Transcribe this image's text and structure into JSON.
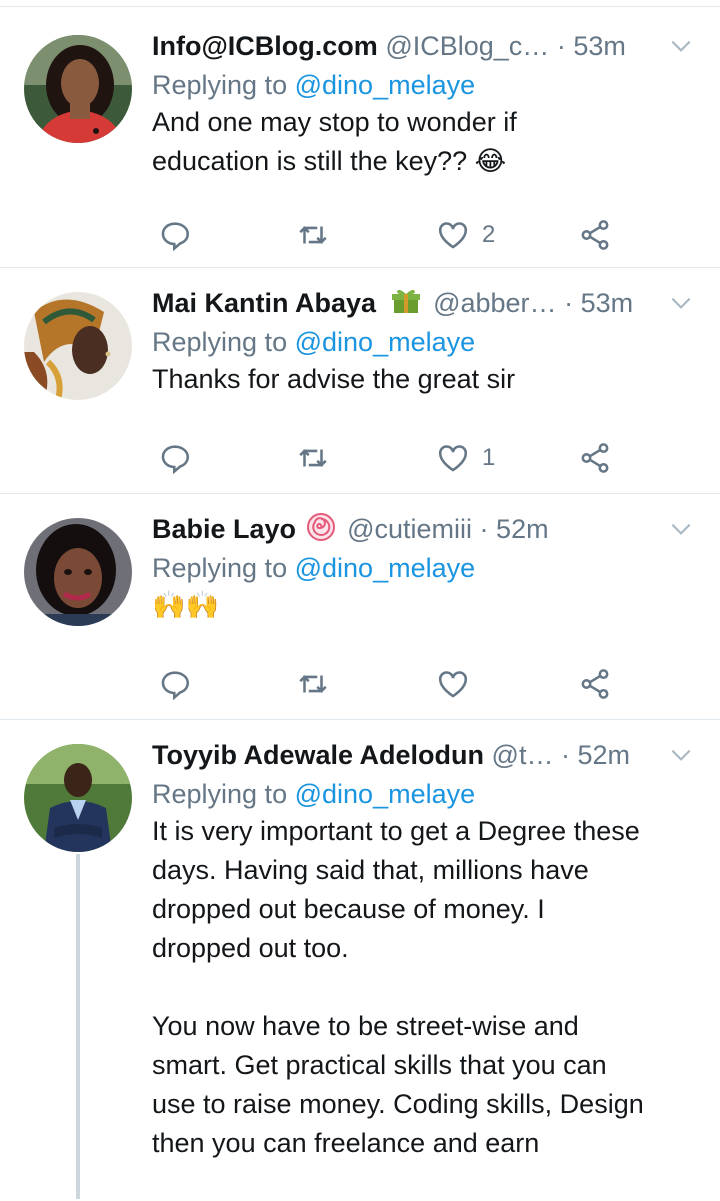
{
  "colors": {
    "link": "#1b95e0",
    "muted": "#657786",
    "divider": "#e1e8ed",
    "text": "#14171a"
  },
  "tweets": [
    {
      "name": "Info@ICBlog.com",
      "handle": "@ICBlog_c…",
      "dot": "·",
      "time": "53m",
      "reply_prefix": "Replying to",
      "reply_to": "@dino_melaye",
      "text": "And one may stop to wonder if\neducation is still the key?? 😂",
      "like_count": "2",
      "avatar": "woman-with-dark-hair-red-top"
    },
    {
      "name": "Mai Kantin Abaya",
      "badge_icon": "green-gift-emoji",
      "handle": "@abber…",
      "dot": "·",
      "time": "53m",
      "reply_prefix": "Replying to",
      "reply_to": "@dino_melaye",
      "text": "Thanks for advise the great sir",
      "like_count": "1",
      "avatar": "woman-with-headwrap"
    },
    {
      "name": "Babie Layo",
      "badge_icon": "swirl-lollipop-emoji",
      "handle": "@cutiemiii",
      "dot": "·",
      "time": "52m",
      "reply_prefix": "Replying to",
      "reply_to": "@dino_melaye",
      "text": "🙌🙌",
      "like_count": "",
      "avatar": "woman-selfie"
    },
    {
      "name": "Toyyib Adewale Adelodun",
      "handle": "@t…",
      "dot": "·",
      "time": "52m",
      "reply_prefix": "Replying to",
      "reply_to": "@dino_melaye",
      "text": "It is very important to get a Degree these\ndays. Having said that, millions have\ndropped out because of money. I\ndropped out too.\n\nYou now have to be street-wise and\nsmart. Get practical skills that you can\nuse to raise money. Coding skills, Design\nthen you can freelance and earn",
      "avatar": "man-in-suit-outdoors"
    }
  ]
}
